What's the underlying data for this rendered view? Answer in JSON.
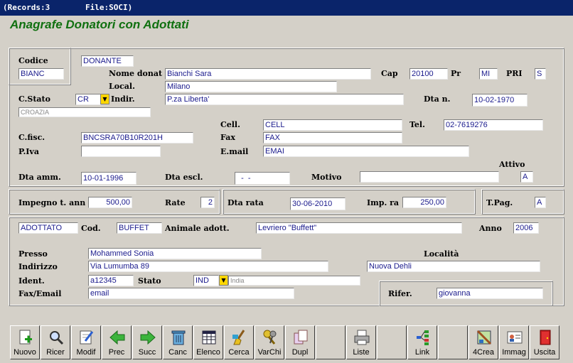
{
  "titlebar": {
    "records": "(Records:3",
    "file": "File:SOCI)"
  },
  "app_title": "Anagrafe Donatori con Adottati",
  "donor": {
    "codice_label": "Codice",
    "codice_type": "DONANTE",
    "codice": "BIANC",
    "nome_label": "Nome donat",
    "nome": "Bianchi Sara",
    "cap_label": "Cap",
    "cap": "20100",
    "pr_label": "Pr",
    "pr": "MI",
    "pri_label": "PRI",
    "pri": "S",
    "local_label": "Local.",
    "local": "Milano",
    "cstato_label": "C.Stato",
    "cstato": "CR",
    "stato_name": "CROAZIA",
    "indir_label": "Indir.",
    "indir": "P.za Liberta'",
    "dtan_label": "Dta n.",
    "dtan": "10-02-1970",
    "cell_label": "Cell.",
    "cell": "CELL",
    "tel_label": "Tel.",
    "tel": "02-7619276",
    "cfisc_label": "C.fisc.",
    "cfisc": "BNCSRA70B10R201H",
    "fax_label": "Fax",
    "fax": "FAX",
    "piva_label": "P.Iva",
    "piva": "",
    "email_label": "E.mail",
    "email": "EMAI",
    "attivo_label": "Attivo",
    "attivo": "A",
    "dtaamm_label": "Dta amm.",
    "dtaamm": "10-01-1996",
    "dtaescl_label": "Dta escl.",
    "dtaescl": "  -  -",
    "motivo_label": "Motivo",
    "motivo": ""
  },
  "payment": {
    "impegno_label": "Impegno t. ann",
    "impegno": "500,00",
    "rate_label": "Rate",
    "rate": "2",
    "dtarata_label": "Dta rata",
    "dtarata": "30-06-2010",
    "imprata_label": "Imp. ra",
    "imprata": "250,00",
    "tpag_label": "T.Pag.",
    "tpag": "A"
  },
  "adoptee": {
    "type": "ADOTTATO",
    "cod_label": "Cod.",
    "cod": "BUFFET",
    "animale_label": "Animale adott.",
    "animale": "Levriero \"Buffett\"",
    "anno_label": "Anno",
    "anno": "2006",
    "presso_label": "Presso",
    "presso": "Mohammed Sonia",
    "localita_label": "Località",
    "indirizzo_label": "Indirizzo",
    "indirizzo": "Via Lumumba 89",
    "localita": "Nuova Dehli",
    "ident_label": "Ident.",
    "ident": "a12345",
    "stato_label": "Stato",
    "stato": "IND",
    "stato_name": "India",
    "faxemail_label": "Fax/Email",
    "faxemail": "email",
    "rifer_label": "Rifer.",
    "rifer": "giovanna"
  },
  "toolbar": {
    "nuovo": "Nuovo",
    "ricer": "Ricer",
    "modif": "Modif",
    "prec": "Prec",
    "succ": "Succ",
    "canc": "Canc",
    "elenco": "Elenco",
    "cerca": "Cerca",
    "varchi": "VarChi",
    "dupl": "Dupl",
    "liste": "Liste",
    "link": "Link",
    "crea": "4Crea",
    "immag": "Immag",
    "uscita": "Uscita"
  },
  "colors": {
    "title_green": "#107010",
    "titlebar_bg": "#0a246a",
    "field_text": "#1a1a8c",
    "dropdown": "#ffd700"
  }
}
